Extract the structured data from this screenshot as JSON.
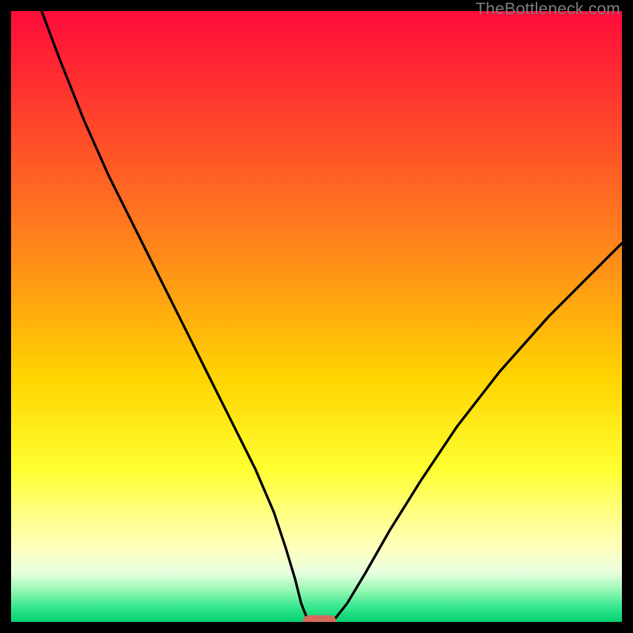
{
  "watermark": "TheBottleneck.com",
  "chart_data": {
    "type": "line",
    "title": "",
    "xlabel": "",
    "ylabel": "",
    "xlim": [
      0,
      100
    ],
    "ylim": [
      0,
      100
    ],
    "gradient_stops": [
      {
        "offset": 0.0,
        "color": "#ff0b3a"
      },
      {
        "offset": 0.2,
        "color": "#ff4a2a"
      },
      {
        "offset": 0.4,
        "color": "#ff8a1a"
      },
      {
        "offset": 0.6,
        "color": "#ffd400"
      },
      {
        "offset": 0.75,
        "color": "#ffff30"
      },
      {
        "offset": 0.82,
        "color": "#ffff80"
      },
      {
        "offset": 0.88,
        "color": "#ffffc0"
      },
      {
        "offset": 0.92,
        "color": "#e8ffe0"
      },
      {
        "offset": 0.95,
        "color": "#90f7b0"
      },
      {
        "offset": 0.975,
        "color": "#38e890"
      },
      {
        "offset": 1.0,
        "color": "#00d070"
      }
    ],
    "series": [
      {
        "name": "bottleneck-curve",
        "x": [
          5,
          8,
          12,
          16,
          20,
          24,
          28,
          32,
          36,
          40,
          43,
          45,
          46.5,
          47.5,
          48.5,
          49,
          52,
          53,
          55,
          58,
          62,
          67,
          73,
          80,
          88,
          97,
          100
        ],
        "y": [
          100,
          92,
          82,
          73,
          65,
          57,
          49,
          41,
          33,
          25,
          18,
          12,
          7,
          3,
          0.5,
          0,
          0,
          0.5,
          3,
          8,
          15,
          23,
          32,
          41,
          50,
          59,
          62
        ]
      }
    ],
    "base_marker": {
      "x": 50.5,
      "y": 0,
      "w": 5.5,
      "h": 2.2,
      "color": "#d66a5a"
    }
  }
}
